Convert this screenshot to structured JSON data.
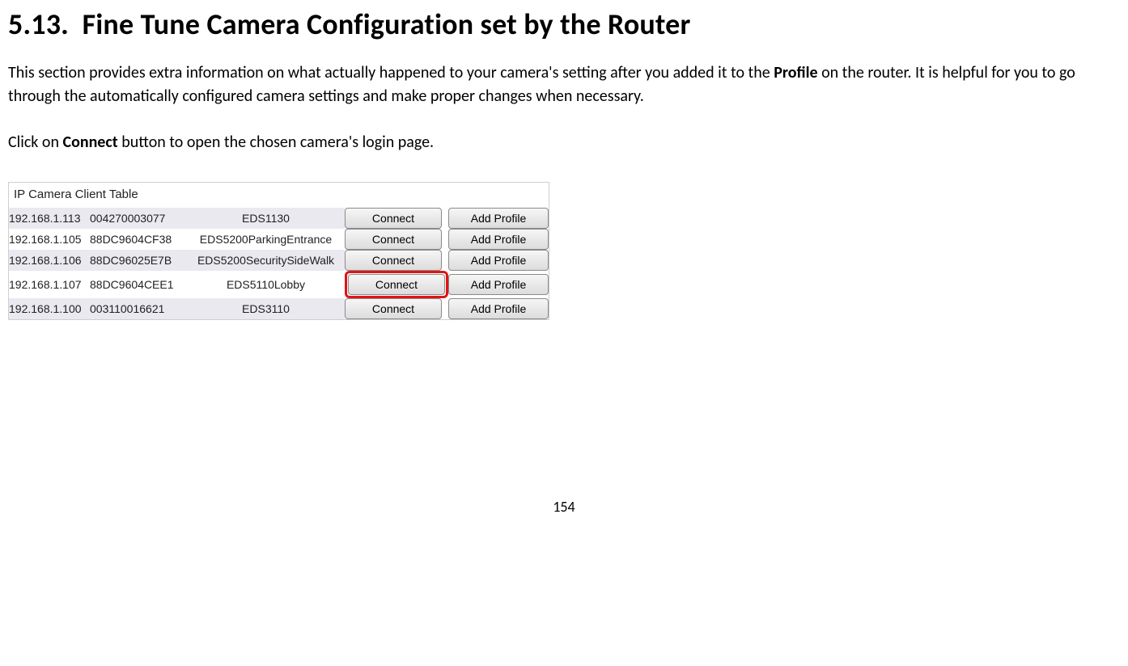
{
  "heading": {
    "number": "5.13.",
    "title": "Fine Tune Camera Configuration set by the Router"
  },
  "paragraphs": {
    "p1_a": "This section provides extra information on what actually happened to your camera's setting after you added it to the ",
    "p1_bold": "Profile",
    "p1_b": " on the router. It is helpful for you to go through the automatically configured camera settings and make proper changes when necessary.",
    "p2_a": "Click on ",
    "p2_bold": "Connect",
    "p2_b": " button to open the chosen camera's login page."
  },
  "table": {
    "title": "IP Camera Client Table",
    "connect_label": "Connect",
    "add_profile_label": "Add Profile",
    "rows": [
      {
        "ip": "192.168.1.113",
        "mac": "004270003077",
        "name": "EDS1130",
        "highlight": false
      },
      {
        "ip": "192.168.1.105",
        "mac": "88DC9604CF38",
        "name": "EDS5200ParkingEntrance",
        "highlight": false
      },
      {
        "ip": "192.168.1.106",
        "mac": "88DC96025E7B",
        "name": "EDS5200SecuritySideWalk",
        "highlight": false
      },
      {
        "ip": "192.168.1.107",
        "mac": "88DC9604CEE1",
        "name": "EDS5110Lobby",
        "highlight": true
      },
      {
        "ip": "192.168.1.100",
        "mac": "003110016621",
        "name": "EDS3110",
        "highlight": false
      }
    ]
  },
  "page_number": "154"
}
